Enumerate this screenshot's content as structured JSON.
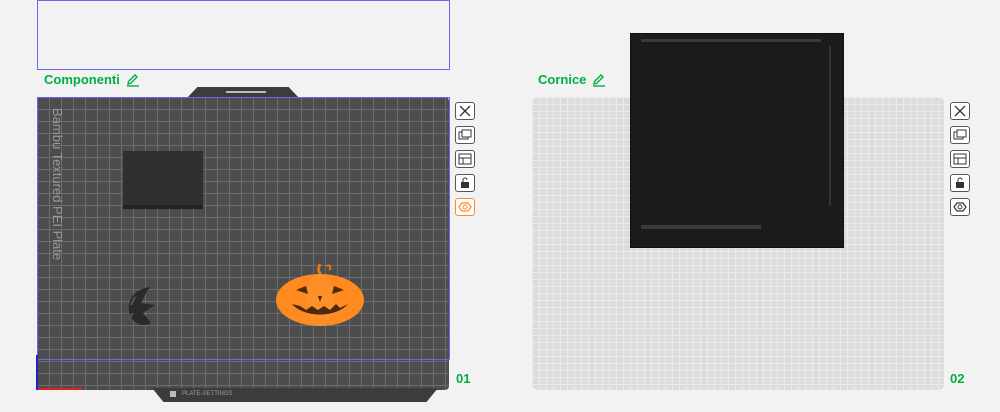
{
  "plates": [
    {
      "name": "Componenti",
      "number": "01",
      "bed_label": "Bambu Textured PEI Plate",
      "bottom_strip_text": "PLATE-SETTINGS",
      "objects": [
        "block",
        "spiral-object",
        "pumpkin"
      ]
    },
    {
      "name": "Cornice",
      "number": "02",
      "objects": [
        "frame"
      ]
    }
  ],
  "toolbar": {
    "buttons": [
      "close",
      "auto-arrange",
      "layout",
      "lock",
      "visibility"
    ]
  },
  "colors": {
    "accent": "#00ae42",
    "bed_dark": "#4d4d4d",
    "bed_light": "#dcdcdc",
    "pumpkin": "#ff8a1f",
    "selection": "#6a6ae6"
  }
}
